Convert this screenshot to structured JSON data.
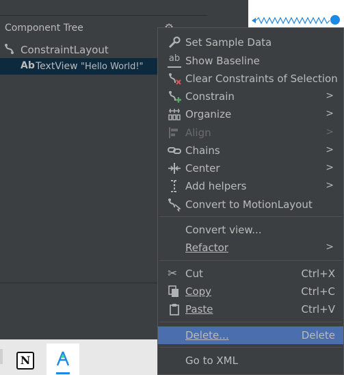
{
  "component_tree": {
    "title": "Component Tree",
    "root_label": "ConstraintLayout",
    "child_prefix": "Ab",
    "child_label": "TextView",
    "child_value": "\"Hello World!\""
  },
  "context_menu": {
    "items": [
      {
        "label": "Set Sample Data"
      },
      {
        "label": "Show Baseline",
        "icon_text": "ab"
      },
      {
        "label": "Clear Constraints of Selection"
      },
      {
        "label": "Constrain",
        "submenu": true
      },
      {
        "label": "Organize",
        "submenu": true
      },
      {
        "label": "Align",
        "submenu": true,
        "disabled": true
      },
      {
        "label": "Chains",
        "submenu": true
      },
      {
        "label": "Center",
        "submenu": true
      },
      {
        "label": "Add helpers",
        "submenu": true
      },
      {
        "label": "Convert to MotionLayout"
      },
      {
        "label": "Convert view..."
      },
      {
        "label": "Refactor",
        "submenu": true
      },
      {
        "label": "Cut",
        "shortcut": "Ctrl+X"
      },
      {
        "label": "Copy",
        "shortcut": "Ctrl+C"
      },
      {
        "label": "Paste",
        "shortcut": "Ctrl+V"
      },
      {
        "label": "Delete...",
        "shortcut": "Delete",
        "selected": true
      },
      {
        "label": "Go to XML"
      }
    ]
  },
  "taskbar": {
    "notion_letter": "N"
  },
  "colors": {
    "panel_bg": "#3c3f41",
    "selection_bg": "#4b6eaf",
    "tree_selection_bg": "#0d293e",
    "text": "#bbbbbb",
    "accent": "#1e88e5"
  }
}
